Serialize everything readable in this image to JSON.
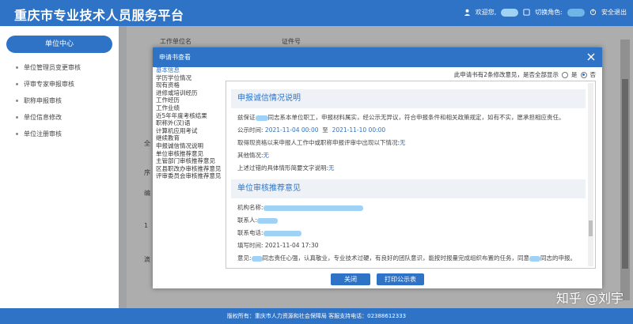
{
  "header": {
    "title": "重庆市专业技术人员服务平台",
    "welcome": "欢迎您,",
    "switch_role": "切换角色:",
    "logout": "安全退出"
  },
  "sidebar": {
    "active": "单位中心",
    "items": [
      {
        "label": "单位管理员变更审核"
      },
      {
        "label": "评审专家申报审核"
      },
      {
        "label": "职称申报审核"
      },
      {
        "label": "单位信息修改"
      },
      {
        "label": "单位注册审核"
      }
    ]
  },
  "background": {
    "col1_header": "工作单位名",
    "col2_header": "证件号",
    "left_marks": [
      "全",
      "序",
      "编",
      "1",
      "滴"
    ]
  },
  "dialog": {
    "title": "申请书查看",
    "nav": [
      "基本信息",
      "学历学位情况",
      "现有资格",
      "进修或培训经历",
      "工作经历",
      "工作业绩",
      "近5年年度考核结果",
      "职称外(汉)语",
      "计算机应用考试",
      "继续教育",
      "申报诚信情况说明",
      "单位审核推荐意见",
      "主管部门审核推荐意见",
      "区县职改办审核推荐意见",
      "评审委员会审核推荐意见"
    ],
    "display_option": {
      "text": "此申请书有2条修改意见，是否全部显示",
      "yes": "是",
      "no": "否",
      "selected": "否"
    },
    "integrity": {
      "title": "申报诚信情况说明",
      "statement_prefix": "兹保证",
      "statement_suffix": "同志系本单位职工，申报材料属实，经公示无异议，符合申报条件和相关政策规定，如有不实，愿承担相应责任。",
      "publicity_label": "公示时间:",
      "publicity_start": "2021-11-04 00:00",
      "publicity_sep": "至",
      "publicity_end": "2021-11-10 00:00",
      "question_label": "取得现资格以来申报人工作中或职称申报评审中出现以下情况:",
      "question_value": "无",
      "other_label": "其他情况:",
      "other_value": "无",
      "desc_label": "上述过错的具体情形简要文字说明:",
      "desc_value": "无"
    },
    "recommend": {
      "title": "单位审核推荐意见",
      "org_label": "机构名称:",
      "contact_label": "联系人:",
      "phone_label": "联系电话:",
      "date_label": "填写时间:",
      "date_value": "2021-11-04 17:30",
      "opinion_label": "意见:",
      "opinion_mid": "同志责任心强，认真敬业，专业技术过硬，有良好的团队意识，能按时报量完成组织布置的任务，同意",
      "opinion_end": "同志的申报。"
    },
    "buttons": {
      "close": "关闭",
      "print": "打印公示表"
    }
  },
  "footer": {
    "text": "版权所有：重庆市人力资源和社会保障局 客服支持电话：02388612333"
  },
  "watermark": "知乎 @刘宇",
  "colors": {
    "primary": "#2f73c6",
    "mask": "#9fd2f5"
  }
}
